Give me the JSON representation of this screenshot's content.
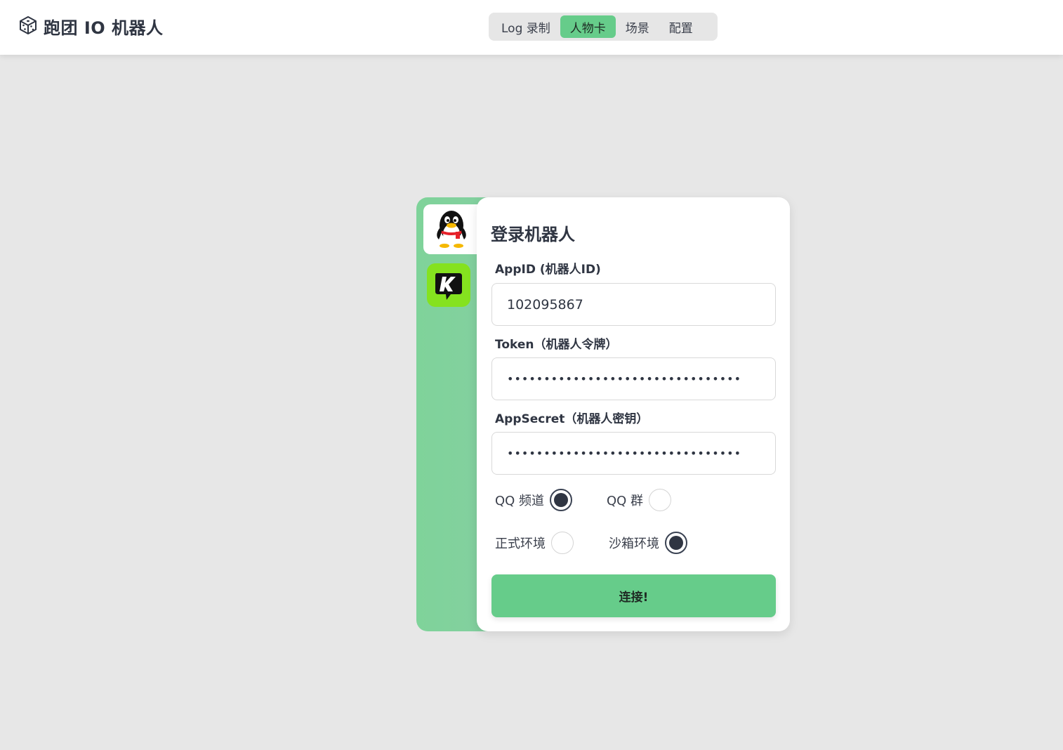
{
  "app": {
    "title": "跑团 IO 机器人",
    "logo_icon": "dice-icon"
  },
  "nav": {
    "tabs": [
      {
        "label": "Log 录制",
        "active": false
      },
      {
        "label": "人物卡",
        "active": true
      },
      {
        "label": "场景",
        "active": false
      },
      {
        "label": "配置",
        "active": false
      }
    ]
  },
  "platforms": [
    {
      "name": "qq-penguin-icon",
      "active": true
    },
    {
      "name": "kook-logo-icon",
      "active": false
    }
  ],
  "login": {
    "title": "登录机器人",
    "appid_label": "AppID (机器人ID)",
    "appid_value": "102095867",
    "token_label": "Token（机器人令牌）",
    "token_value": "••••••••••••••••••••••••••••••••",
    "secret_label": "AppSecret（机器人密钥）",
    "secret_value": "••••••••••••••••••••••••••••••••",
    "channel_options": [
      {
        "label": "QQ 频道",
        "checked": true
      },
      {
        "label": "QQ 群",
        "checked": false
      }
    ],
    "env_options": [
      {
        "label": "正式环境",
        "checked": false
      },
      {
        "label": "沙箱环境",
        "checked": true
      }
    ],
    "connect_label": "连接!"
  },
  "colors": {
    "accent": "#66cc8a",
    "background": "#e7e7e7",
    "text": "#2f3542"
  }
}
